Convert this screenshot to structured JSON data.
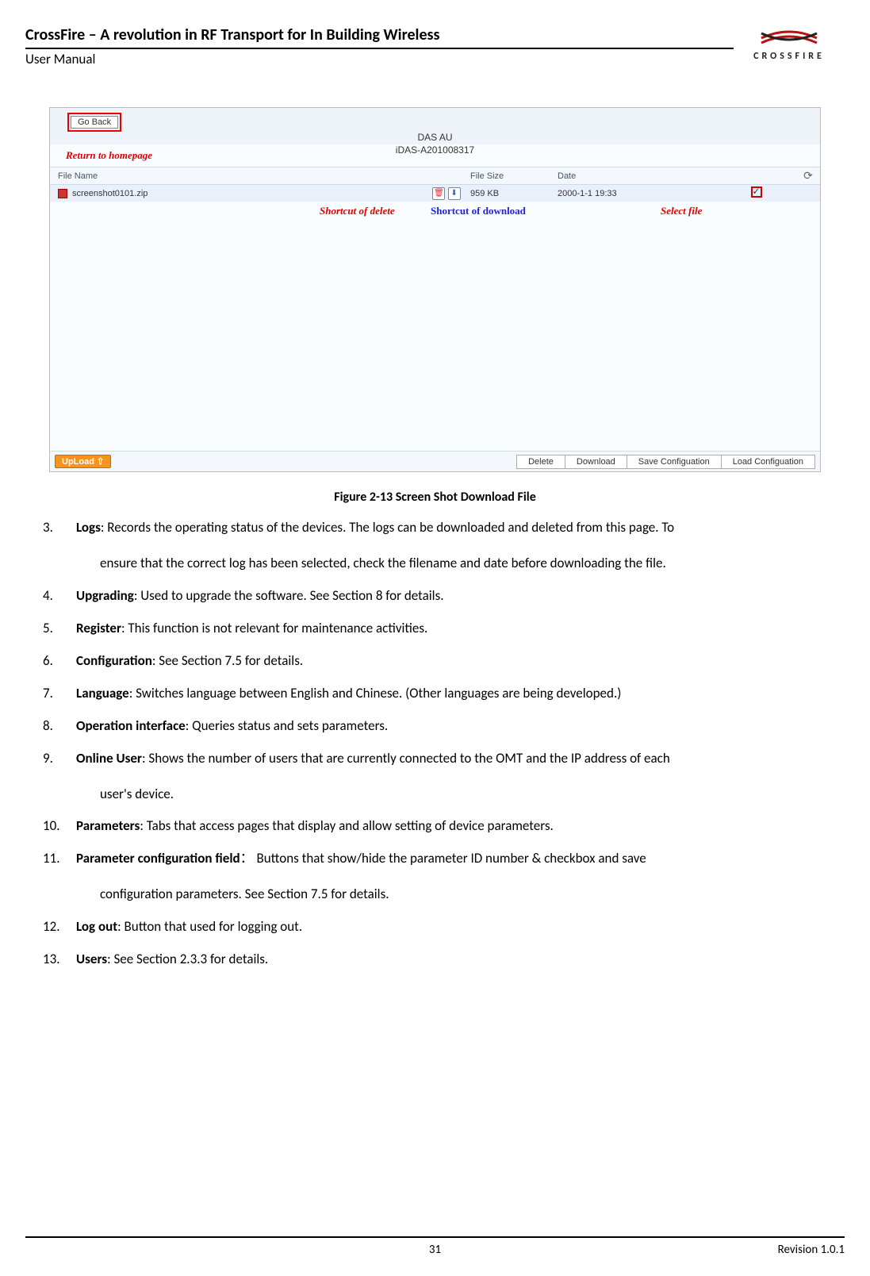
{
  "header": {
    "title": "CrossFire – A revolution in RF Transport for In Building Wireless",
    "subtitle": "User Manual",
    "brand": "CROSSFIRE"
  },
  "figure": {
    "caption": "Figure 2-13 Screen Shot Download File",
    "goback": "Go Back",
    "return_home": "Return to homepage",
    "device_name": "DAS AU",
    "device_id": "iDAS-A201008317",
    "col_filename": "File Name",
    "col_filesize": "File Size",
    "col_date": "Date",
    "row_name": "screenshot0101.zip",
    "row_size": "959 KB",
    "row_date": "2000-1-1 19:33",
    "annot_delete": "Shortcut of delete",
    "annot_download": "Shortcut of download",
    "annot_select": "Select file",
    "upload": "UpLoad ⇧",
    "btn_delete": "Delete",
    "btn_download": "Download",
    "btn_savecfg": "Save Configuation",
    "btn_loadcfg": "Load Configuation",
    "refresh_glyph": "⟳",
    "trash_glyph": "🗑",
    "dl_glyph": "⬇"
  },
  "items": [
    {
      "n": "3.",
      "term": "Logs",
      "text": ": Records the operating status of the devices. The logs can be downloaded and deleted from this page. To",
      "cont": "ensure that the correct log has been selected, check the filename and date before downloading the file."
    },
    {
      "n": "4.",
      "term": "Upgrading",
      "text": ": Used to upgrade the software. See Section 8 for details."
    },
    {
      "n": "5.",
      "term": "Register",
      "text": ": This function is not relevant for maintenance activities."
    },
    {
      "n": "6.",
      "term": "Configuration",
      "text": ": See Section 7.5 for details."
    },
    {
      "n": "7.",
      "term": "Language",
      "text": ": Switches language between English and Chinese. (Other languages are being developed.)"
    },
    {
      "n": "8.",
      "term": "Operation interface",
      "text": ": Queries status and sets parameters."
    },
    {
      "n": "9.",
      "term": "Online User",
      "text": ": Shows the number of users that are currently connected to the OMT and the IP address of each",
      "cont": "user's device."
    },
    {
      "n": "10.",
      "term": "Parameters",
      "text": ": Tabs that access pages that display and allow setting of device parameters."
    },
    {
      "n": "11.",
      "term": "Parameter configuration field",
      "text": "： Buttons that show/hide the parameter ID number & checkbox and save",
      "cont": "configuration parameters. See Section 7.5 for details."
    },
    {
      "n": "12.",
      "term": "Log out",
      "text": ": Button that used for logging out."
    },
    {
      "n": "13.",
      "term": "Users",
      "text": ": See Section 2.3.3 for details."
    }
  ],
  "footer": {
    "page": "31",
    "rev": "Revision 1.0.1"
  }
}
